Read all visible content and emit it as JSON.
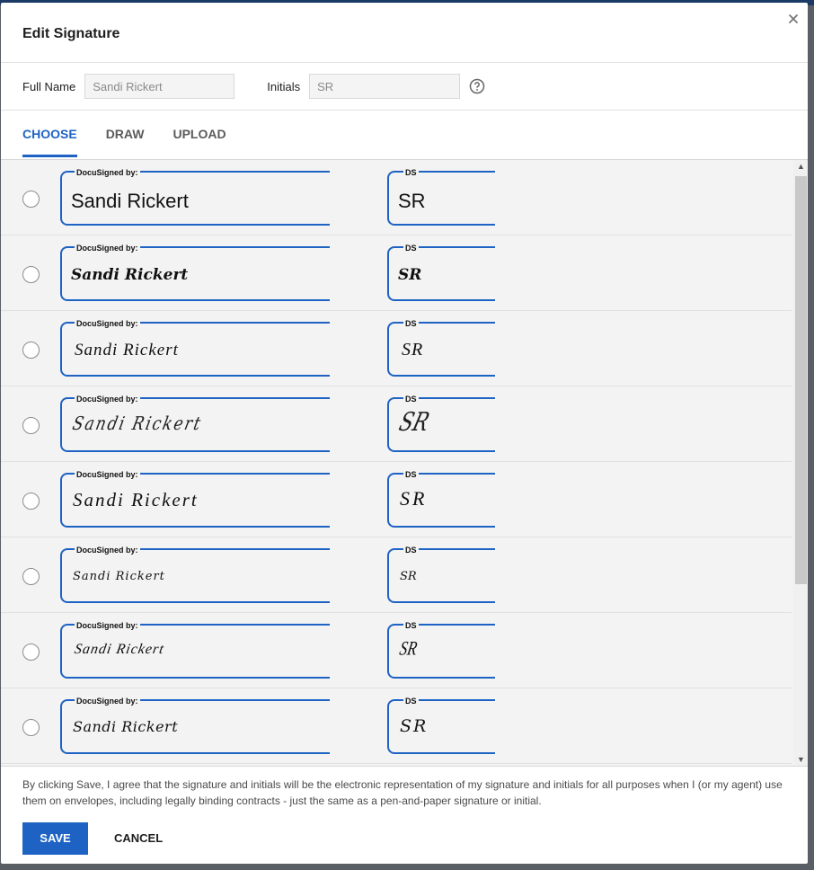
{
  "dialog": {
    "title": "Edit Signature",
    "close_icon": "close-icon"
  },
  "fields": {
    "full_name_label": "Full Name",
    "full_name_value": "Sandi Rickert",
    "initials_label": "Initials",
    "initials_value": "SR",
    "help_icon": "question-circle-icon"
  },
  "tabs": [
    {
      "label": "CHOOSE",
      "active": true
    },
    {
      "label": "DRAW",
      "active": false
    },
    {
      "label": "UPLOAD",
      "active": false
    }
  ],
  "signature_options": [
    {
      "caption": "DocuSigned by:",
      "initials_caption": "DS",
      "signature": "Sandi Rickert",
      "initials": "SR",
      "selected": false
    },
    {
      "caption": "DocuSigned by:",
      "initials_caption": "DS",
      "signature": "Sandi Rickert",
      "initials": "SR",
      "selected": false
    },
    {
      "caption": "DocuSigned by:",
      "initials_caption": "DS",
      "signature": "Sandi Rickert",
      "initials": "SR",
      "selected": false
    },
    {
      "caption": "DocuSigned by:",
      "initials_caption": "DS",
      "signature": "Sandi Rickert",
      "initials": "SR",
      "selected": false
    },
    {
      "caption": "DocuSigned by:",
      "initials_caption": "DS",
      "signature": "Sandi Rickert",
      "initials": "SR",
      "selected": false
    },
    {
      "caption": "DocuSigned by:",
      "initials_caption": "DS",
      "signature": "Sandi Rickert",
      "initials": "SR",
      "selected": false
    },
    {
      "caption": "DocuSigned by:",
      "initials_caption": "DS",
      "signature": "Sandi Rickert",
      "initials": "SR",
      "selected": false
    },
    {
      "caption": "DocuSigned by:",
      "initials_caption": "DS",
      "signature": "Sandi Rickert",
      "initials": "SR",
      "selected": false
    }
  ],
  "disclaimer": "By clicking Save, I agree that the signature and initials will be the electronic representation of my signature and initials for all purposes when I (or my agent) use them on envelopes, including legally binding contracts - just the same as a pen-and-paper signature or initial.",
  "buttons": {
    "save": "SAVE",
    "cancel": "CANCEL"
  },
  "colors": {
    "accent": "#1e63c4",
    "list_background": "#f3f3f3"
  }
}
